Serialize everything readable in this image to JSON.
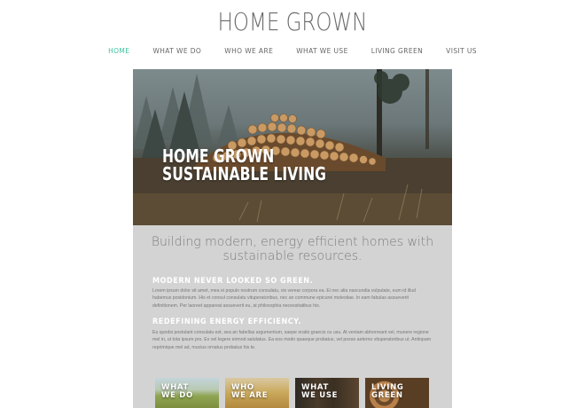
{
  "site": {
    "title": "HOME GROWN"
  },
  "nav": {
    "items": [
      {
        "label": "HOME",
        "active": true
      },
      {
        "label": "WHAT WE DO",
        "active": false
      },
      {
        "label": "WHO WE ARE",
        "active": false
      },
      {
        "label": "WHAT WE USE",
        "active": false
      },
      {
        "label": "LIVING GREEN",
        "active": false
      },
      {
        "label": "VISIT US",
        "active": false
      }
    ],
    "active_color": "#3fc1a0"
  },
  "hero": {
    "line1": "HOME GROWN",
    "line2": "SUSTAINABLE LIVING"
  },
  "main": {
    "tagline": "Building modern, energy efficient homes with sustainable resources.",
    "sections": [
      {
        "heading": "MODERN NEVER LOOKED SO GREEN.",
        "body": "Lorem ipsum dolor sit amet, mea ei populo nostrum consulatu, vis verear corpora ea. Ei nec alia nascundia vulputate, eum id illud habemus posidonium. His et consul consulatu vituperatoribus, nec an commune epicurei molestiae. In eam fabulas assueverit definitionem. Per laoreet appareat assueverit eu, at philosophia necessitatibus his."
      },
      {
        "heading": "REDEFINING ENERGY EFFICIENCY.",
        "body": "Eu quodsi postulant consulatu est, sea an fabellas argumentum, saepe oratio graecis cu usu. At veniam abhorreant vel, munere regione mel in, ut tota ipsum pro. Ex vel legere eirmod salutatus. Ea eos modo quaeque probatus, vel posse aeterno vituperatoribus ut. Antiopam reprimique mel ad, mucius ornatus probatus his te."
      }
    ]
  },
  "cards": [
    {
      "label": "WHAT\nWE DO"
    },
    {
      "label": "WHO\nWE ARE"
    },
    {
      "label": "WHAT\nWE USE"
    },
    {
      "label": "LIVING\nGREEN"
    }
  ]
}
